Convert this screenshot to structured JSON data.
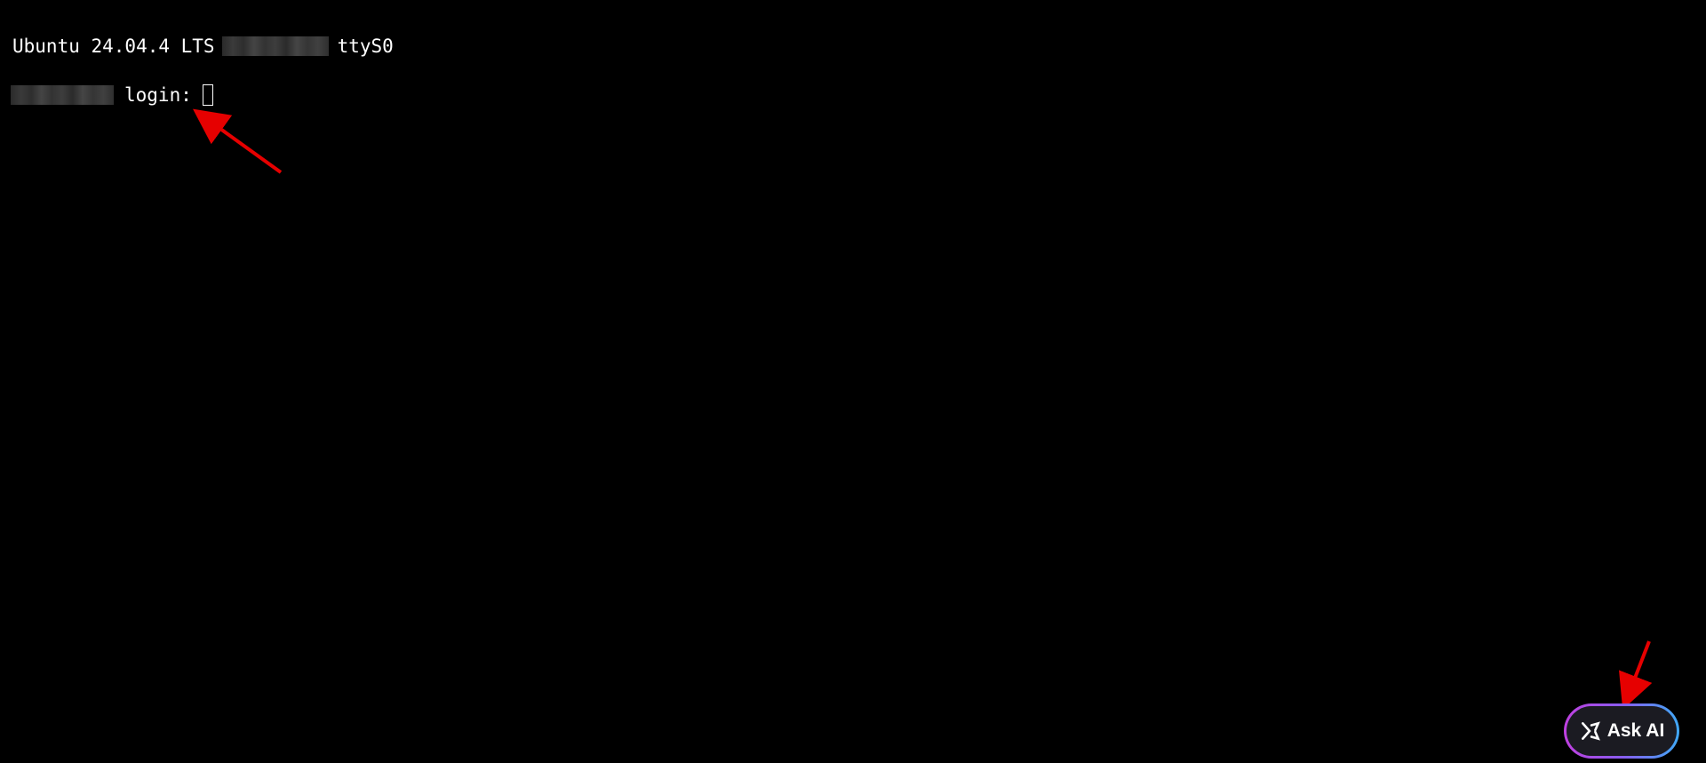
{
  "terminal": {
    "os_label": "Ubuntu 24.04.4 LTS",
    "tty": "ttyS0",
    "login_prompt": "login:"
  },
  "ask_ai_button": {
    "label": "Ask AI",
    "icon": "sparkle-icon"
  },
  "colors": {
    "background": "#000000",
    "text": "#ffffff",
    "annotation": "#e60000",
    "ask_ai_gradient_start": "#c040e0",
    "ask_ai_gradient_end": "#3fa8f5"
  }
}
